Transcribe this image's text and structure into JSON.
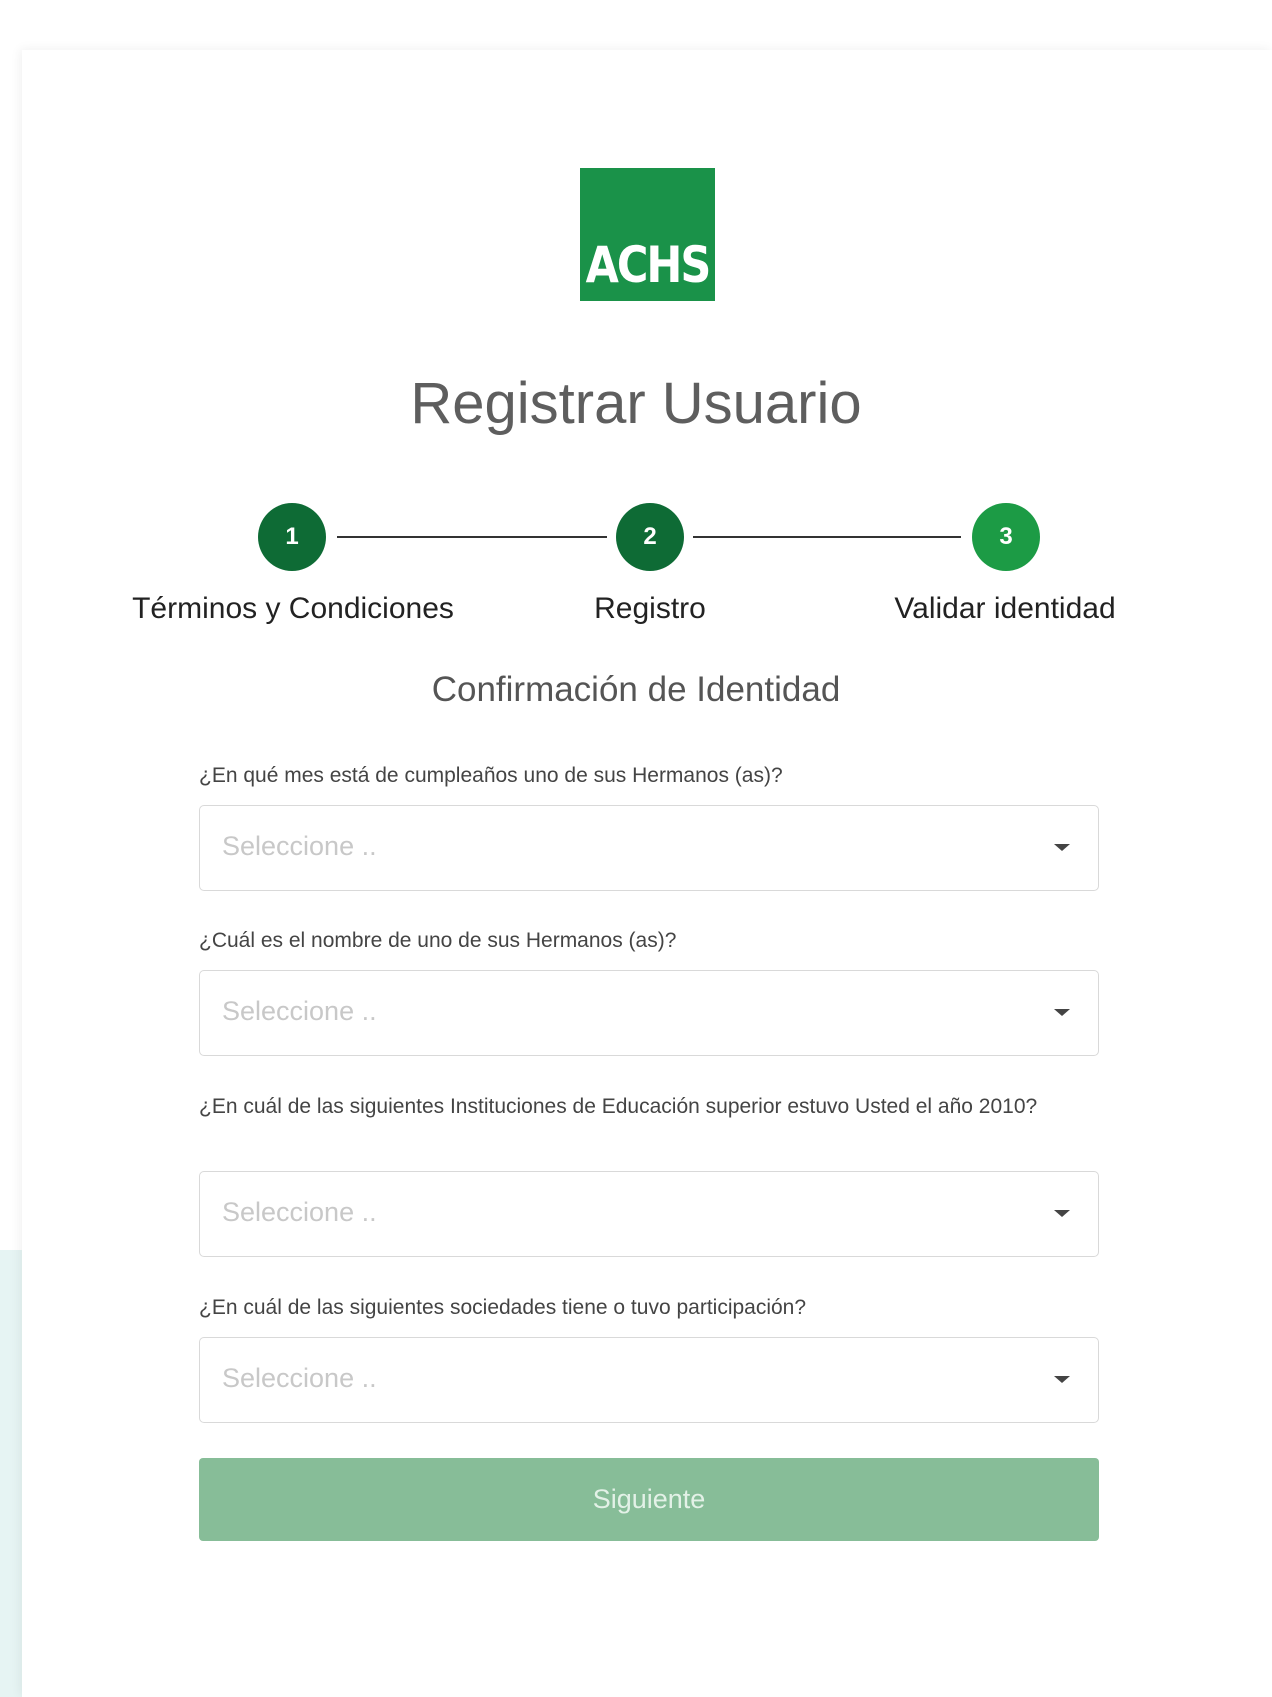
{
  "brand": {
    "logo_text": "ACHS",
    "color": "#1a9249"
  },
  "title": "Registrar Usuario",
  "stepper": {
    "steps": [
      {
        "number": "1",
        "label": "Términos y Condiciones",
        "state": "done"
      },
      {
        "number": "2",
        "label": "Registro",
        "state": "done"
      },
      {
        "number": "3",
        "label": "Validar identidad",
        "state": "active"
      }
    ]
  },
  "subtitle": "Confirmación de Identidad",
  "questions": [
    {
      "label": "¿En qué mes está de cumpleaños uno de sus Hermanos (as)?",
      "placeholder": "Seleccione .."
    },
    {
      "label": "¿Cuál es el nombre de uno de sus Hermanos (as)?",
      "placeholder": "Seleccione .."
    },
    {
      "label": "¿En cuál de las siguientes Instituciones de Educación superior estuvo Usted el año 2010?",
      "placeholder": "Seleccione .."
    },
    {
      "label": "¿En cuál de las siguientes sociedades tiene o tuvo participación?",
      "placeholder": "Seleccione .."
    }
  ],
  "submit": {
    "label": "Siguiente",
    "state": "disabled"
  },
  "colors": {
    "step_done": "#0e6b35",
    "step_active": "#1c9b45",
    "button_disabled": "#87bd98"
  }
}
